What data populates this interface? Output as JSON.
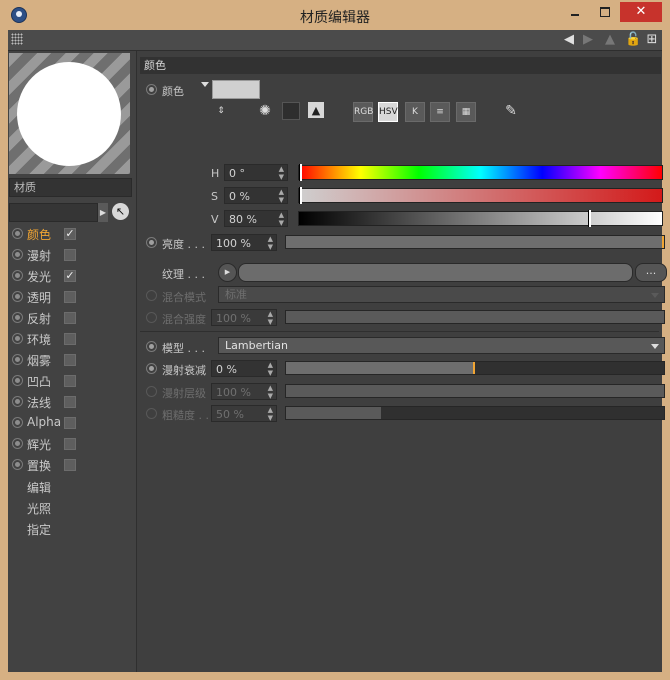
{
  "window": {
    "title": "材质编辑器",
    "close_glyph": "✕"
  },
  "toolbar": {
    "icons": [
      "back-arrow-icon",
      "forward-arrow-icon",
      "up-arrow-icon",
      "lock-icon",
      "new-window-icon"
    ],
    "glyphs": {
      "back": "◀",
      "forward": "▶",
      "up": "▲",
      "lock": "🔓",
      "new": "⊞"
    }
  },
  "material": {
    "name": "材质",
    "pick_glyph": "↖"
  },
  "channels": [
    {
      "label": "颜色",
      "checked": true,
      "active": true
    },
    {
      "label": "漫射",
      "checked": false,
      "active": false
    },
    {
      "label": "发光",
      "checked": true,
      "active": false
    },
    {
      "label": "透明",
      "checked": false,
      "active": false
    },
    {
      "label": "反射",
      "checked": false,
      "active": false
    },
    {
      "label": "环境",
      "checked": false,
      "active": false
    },
    {
      "label": "烟雾",
      "checked": false,
      "active": false
    },
    {
      "label": "凹凸",
      "checked": false,
      "active": false
    },
    {
      "label": "法线",
      "checked": false,
      "active": false
    },
    {
      "label": "Alpha",
      "checked": false,
      "active": false
    },
    {
      "label": "辉光",
      "checked": false,
      "active": false
    },
    {
      "label": "置换",
      "checked": false,
      "active": false
    }
  ],
  "nav": [
    "编辑",
    "光照",
    "指定"
  ],
  "check_glyph": "✓",
  "section": {
    "title": "颜色"
  },
  "color": {
    "label": "颜色",
    "swatch": "#d0d0d0",
    "modes": [
      "RGB",
      "HSV",
      "K"
    ],
    "h": {
      "label": "H",
      "value": "0 °",
      "fraction": 0.0
    },
    "s": {
      "label": "S",
      "value": "0 %",
      "fraction": 0.0
    },
    "v": {
      "label": "V",
      "value": "80 %",
      "fraction": 0.8
    }
  },
  "brightness": {
    "label": "亮度 . . .",
    "value": "100 %",
    "fraction": 1.0
  },
  "texture": {
    "label": "纹理 . . .",
    "more": "..."
  },
  "blend_mode": {
    "label": "混合模式",
    "value": "标准"
  },
  "blend_strength": {
    "label": "混合强度",
    "value": "100 %",
    "fraction": 1.0
  },
  "model": {
    "label": "模型 . . .",
    "value": "Lambertian"
  },
  "diffuse_falloff": {
    "label": "漫射衰减",
    "value": "0 %",
    "fraction": 0.5
  },
  "diffuse_level": {
    "label": "漫射层级",
    "value": "100 %",
    "fraction": 1.0
  },
  "roughness": {
    "label": "粗糙度 . .",
    "value": "50 %",
    "fraction": 0.25
  },
  "colors": {
    "accent": "#f1a533",
    "panel": "#3f3f3f",
    "frame": "#d6b083",
    "close": "#c7332c"
  }
}
